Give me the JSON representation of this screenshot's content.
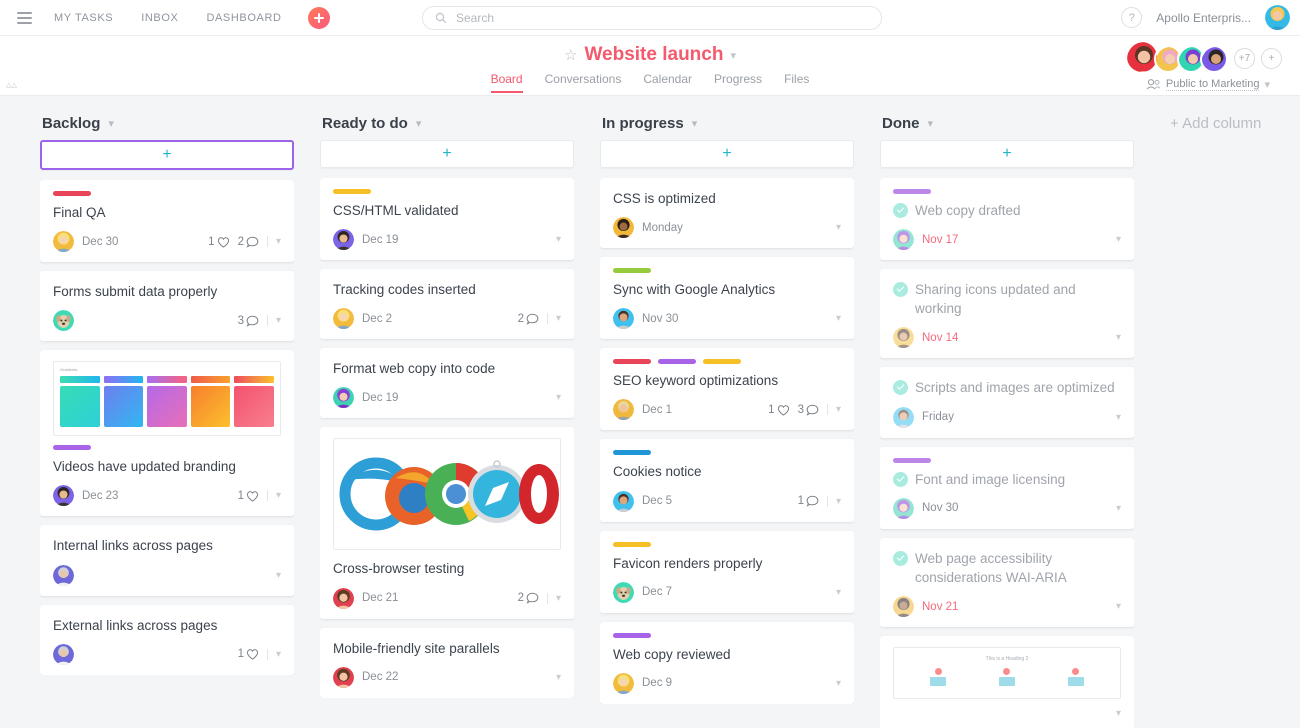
{
  "topbar": {
    "nav": [
      {
        "label": "MY TASKS",
        "name": "nav-my-tasks"
      },
      {
        "label": "INBOX",
        "name": "nav-inbox"
      },
      {
        "label": "DASHBOARD",
        "name": "nav-dashboard"
      }
    ],
    "search_placeholder": "Search",
    "search_value": "",
    "help_label": "?",
    "org_name": "Apollo Enterpris..."
  },
  "project": {
    "title": "Website launch",
    "tabs": [
      {
        "label": "Board",
        "active": true
      },
      {
        "label": "Conversations",
        "active": false
      },
      {
        "label": "Calendar",
        "active": false
      },
      {
        "label": "Progress",
        "active": false
      },
      {
        "label": "Files",
        "active": false
      }
    ],
    "member_overflow": "+7",
    "privacy": "Public to Marketing",
    "accent_color": "#f4596d"
  },
  "board": {
    "add_column_label": "+ Add column",
    "add_card_label": "+",
    "columns": [
      {
        "title": "Backlog",
        "add_focused": true,
        "cards": [
          {
            "title": "Final QA",
            "tags": [
              "#e8445a"
            ],
            "date": "Dec 30",
            "likes": "1",
            "comments": "2",
            "avatar": "blonde-woman",
            "done": false
          },
          {
            "title": "Forms submit data properly",
            "tags": [],
            "date": "",
            "likes": "",
            "comments": "3",
            "avatar": "dog",
            "done": false
          },
          {
            "title": "Videos have updated branding",
            "tags": [
              "#a963e8"
            ],
            "date": "Dec 23",
            "likes": "1",
            "comments": "",
            "avatar": "man-purple",
            "done": false,
            "thumb": "gradients",
            "thumb_label": "Gradients"
          },
          {
            "title": "Internal links across pages",
            "tags": [],
            "date": "",
            "likes": "",
            "comments": "",
            "avatar": "man-indigo",
            "done": false
          },
          {
            "title": "External links across pages",
            "tags": [],
            "date": "",
            "likes": "1",
            "comments": "",
            "avatar": "man-indigo",
            "done": false
          }
        ]
      },
      {
        "title": "Ready to do",
        "add_focused": false,
        "cards": [
          {
            "title": "CSS/HTML validated",
            "tags": [
              "#f5c026"
            ],
            "date": "Dec 19",
            "likes": "",
            "comments": "",
            "avatar": "man-purple",
            "done": false
          },
          {
            "title": "Tracking codes inserted",
            "tags": [],
            "date": "Dec 2",
            "likes": "",
            "comments": "2",
            "avatar": "blonde-woman",
            "done": false
          },
          {
            "title": "Format web copy into code",
            "tags": [],
            "date": "Dec 19",
            "likes": "",
            "comments": "",
            "avatar": "purple-hair",
            "done": false
          },
          {
            "title": "Cross-browser testing",
            "tags": [],
            "date": "Dec 21",
            "likes": "",
            "comments": "2",
            "avatar": "brunette",
            "done": false,
            "thumb": "browsers"
          },
          {
            "title": "Mobile-friendly site parallels",
            "tags": [],
            "date": "Dec 22",
            "likes": "",
            "comments": "",
            "avatar": "brunette",
            "done": false
          }
        ]
      },
      {
        "title": "In progress",
        "add_focused": false,
        "cards": [
          {
            "title": "CSS is optimized",
            "tags": [],
            "date": "Monday",
            "likes": "",
            "comments": "",
            "avatar": "woman-dark",
            "done": false
          },
          {
            "title": "Sync with Google Analytics",
            "tags": [
              "#96ca3e"
            ],
            "date": "Nov 30",
            "likes": "",
            "comments": "",
            "avatar": "man-cyan",
            "done": false
          },
          {
            "title": "SEO keyword optimizations",
            "tags": [
              "#e8445a",
              "#a963e8",
              "#f5c026"
            ],
            "date": "Dec 1",
            "likes": "1",
            "comments": "3",
            "avatar": "blonde-man",
            "done": false
          },
          {
            "title": "Cookies notice",
            "tags": [
              "#2196d6"
            ],
            "date": "Dec 5",
            "likes": "",
            "comments": "1",
            "avatar": "man-cyan",
            "done": false
          },
          {
            "title": "Favicon renders properly",
            "tags": [
              "#f5c026"
            ],
            "date": "Dec 7",
            "likes": "",
            "comments": "",
            "avatar": "dog",
            "done": false
          },
          {
            "title": "Web copy reviewed",
            "tags": [
              "#a963e8"
            ],
            "date": "Dec 9",
            "likes": "",
            "comments": "",
            "avatar": "blonde-woman",
            "done": false
          }
        ]
      },
      {
        "title": "Done",
        "add_focused": false,
        "cards": [
          {
            "title": "Web copy drafted",
            "tags": [
              "#bb86e8"
            ],
            "date": "Nov 17",
            "date_overdue": true,
            "likes": "",
            "comments": "",
            "avatar": "purple-hair",
            "done": true
          },
          {
            "title": "Sharing icons updated and working",
            "tags": [],
            "date": "Nov 14",
            "date_overdue": true,
            "likes": "",
            "comments": "",
            "avatar": "woman-yellow",
            "done": true
          },
          {
            "title": "Scripts and images are optimized",
            "tags": [],
            "date": "Friday",
            "date_overdue": false,
            "likes": "",
            "comments": "",
            "avatar": "man-cyan",
            "done": true
          },
          {
            "title": "Font and image licensing",
            "tags": [
              "#bb86e8"
            ],
            "date": "Nov 30",
            "date_overdue": false,
            "likes": "",
            "comments": "",
            "avatar": "purple-hair",
            "done": true
          },
          {
            "title": "Web page accessibility considerations WAI-ARIA",
            "tags": [],
            "date": "Nov 21",
            "date_overdue": true,
            "likes": "",
            "comments": "",
            "avatar": "woman-dark",
            "done": true
          },
          {
            "title": "",
            "tags": [],
            "date": "",
            "likes": "",
            "comments": "",
            "avatar": "",
            "done": true,
            "thumb": "heading",
            "thumb_label": "This is a Heading 2"
          }
        ]
      }
    ]
  },
  "gradients_thumb": {
    "strips": [
      [
        "#3ddbb0",
        "#20b7f0"
      ],
      [
        "#8f6ef5",
        "#20b7f0"
      ],
      [
        "#a86ef0",
        "#f8627e"
      ],
      [
        "#f05a4a",
        "#f9a12c"
      ],
      [
        "#ee4b5e",
        "#f9c22c"
      ]
    ],
    "boxes": [
      [
        "#36dcb6",
        "#2fd0d8"
      ],
      [
        "#6d7ff0",
        "#31b7f0"
      ],
      [
        "#b469e8",
        "#e86fb8"
      ],
      [
        "#f77e2e",
        "#fbc02d"
      ],
      [
        "#f4526e",
        "#f77f8e"
      ]
    ]
  }
}
